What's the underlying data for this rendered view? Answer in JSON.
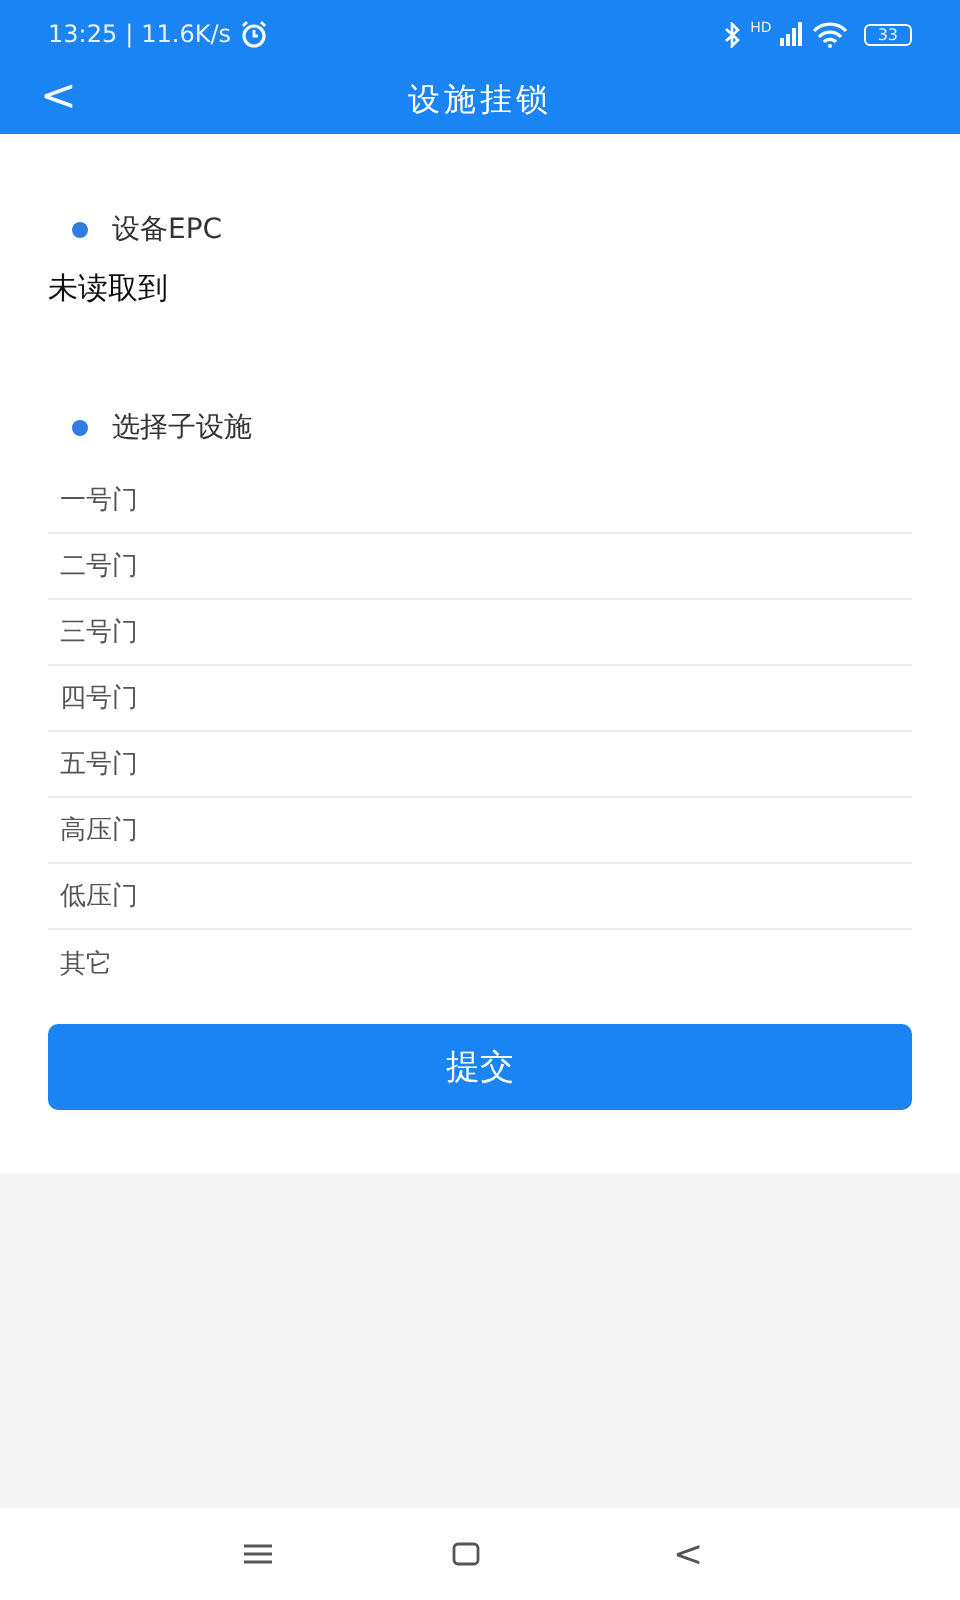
{
  "status_bar": {
    "time": "13:25",
    "separator": "|",
    "speed": "11.6K/s",
    "network_label": "HD",
    "battery": "33"
  },
  "header": {
    "back": "<",
    "title": "设施挂锁"
  },
  "sections": [
    {
      "label": "设备EPC",
      "value": "未读取到"
    },
    {
      "label": "选择子设施"
    }
  ],
  "options": [
    "一号门",
    "二号门",
    "三号门",
    "四号门",
    "五号门",
    "高压门",
    "低压门",
    "其它"
  ],
  "submit": "提交",
  "nav": {
    "back": "<"
  }
}
